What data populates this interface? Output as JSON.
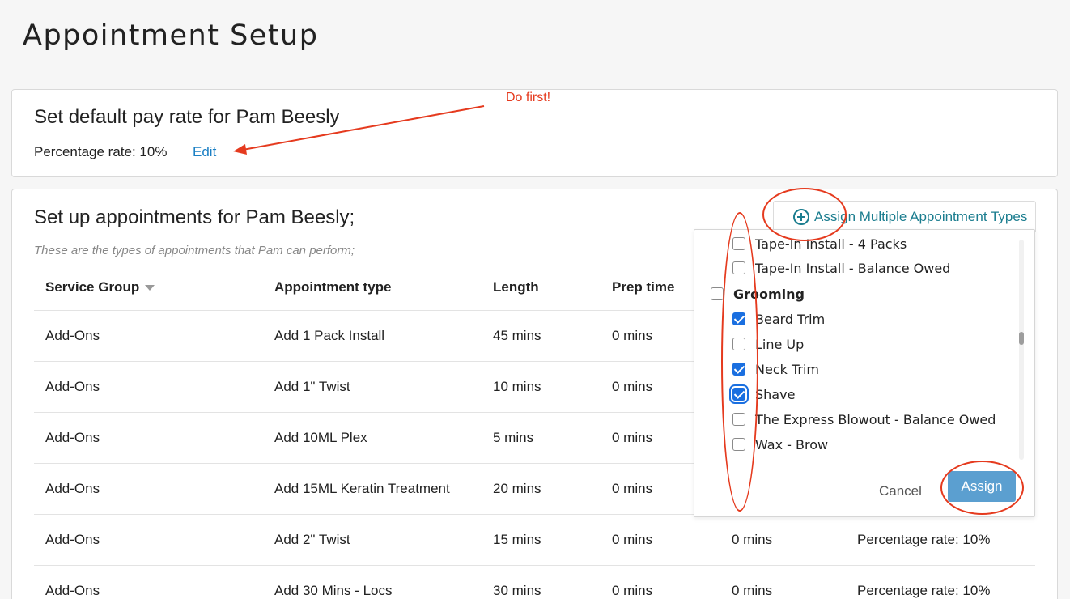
{
  "page": {
    "title": "Appointment Setup"
  },
  "pay_card": {
    "heading": "Set default pay rate for Pam Beesly",
    "rate_text": "Percentage rate: 10%",
    "edit_label": "Edit"
  },
  "appt_card": {
    "heading": "Set up appointments for Pam Beesly;",
    "subtitle": "These are the types of appointments that Pam can perform;",
    "assign_multiple_label": "Assign Multiple Appointment Types"
  },
  "table": {
    "columns": [
      "Service Group",
      "Appointment type",
      "Length",
      "Prep time",
      "",
      ""
    ],
    "rows": [
      [
        "Add-Ons",
        "Add 1 Pack Install",
        "45 mins",
        "0 mins",
        "",
        ""
      ],
      [
        "Add-Ons",
        "Add 1\" Twist",
        "10 mins",
        "0 mins",
        "",
        ""
      ],
      [
        "Add-Ons",
        "Add 10ML Plex",
        "5 mins",
        "0 mins",
        "",
        ""
      ],
      [
        "Add-Ons",
        "Add 15ML Keratin Treatment",
        "20 mins",
        "0 mins",
        "",
        ""
      ],
      [
        "Add-Ons",
        "Add 2\" Twist",
        "15 mins",
        "0 mins",
        "0 mins",
        "Percentage rate: 10%"
      ],
      [
        "Add-Ons",
        "Add 30 Mins - Locs",
        "30 mins",
        "0 mins",
        "0 mins",
        "Percentage rate: 10%"
      ]
    ]
  },
  "dropdown": {
    "items": [
      {
        "label": "Tape-In Install - 4 Packs",
        "checked": false,
        "group": false
      },
      {
        "label": "Tape-In Install - Balance Owed",
        "checked": false,
        "group": false
      },
      {
        "label": "Grooming",
        "checked": false,
        "group": true
      },
      {
        "label": "Beard Trim",
        "checked": true,
        "group": false
      },
      {
        "label": "Line Up",
        "checked": false,
        "group": false
      },
      {
        "label": "Neck Trim",
        "checked": true,
        "group": false
      },
      {
        "label": "Shave",
        "checked": true,
        "group": false,
        "focused": true
      },
      {
        "label": "The Express Blowout - Balance Owed",
        "checked": false,
        "group": false
      },
      {
        "label": "Wax - Brow",
        "checked": false,
        "group": false
      }
    ],
    "cancel_label": "Cancel",
    "assign_label": "Assign"
  },
  "annotation": {
    "note": "Do first!",
    "color": "#e53a1e"
  },
  "colors": {
    "link": "#1a7fc4",
    "teal": "#1b7d8f",
    "checkbox": "#1a6fe0",
    "assign_button": "#5b9fd0"
  }
}
